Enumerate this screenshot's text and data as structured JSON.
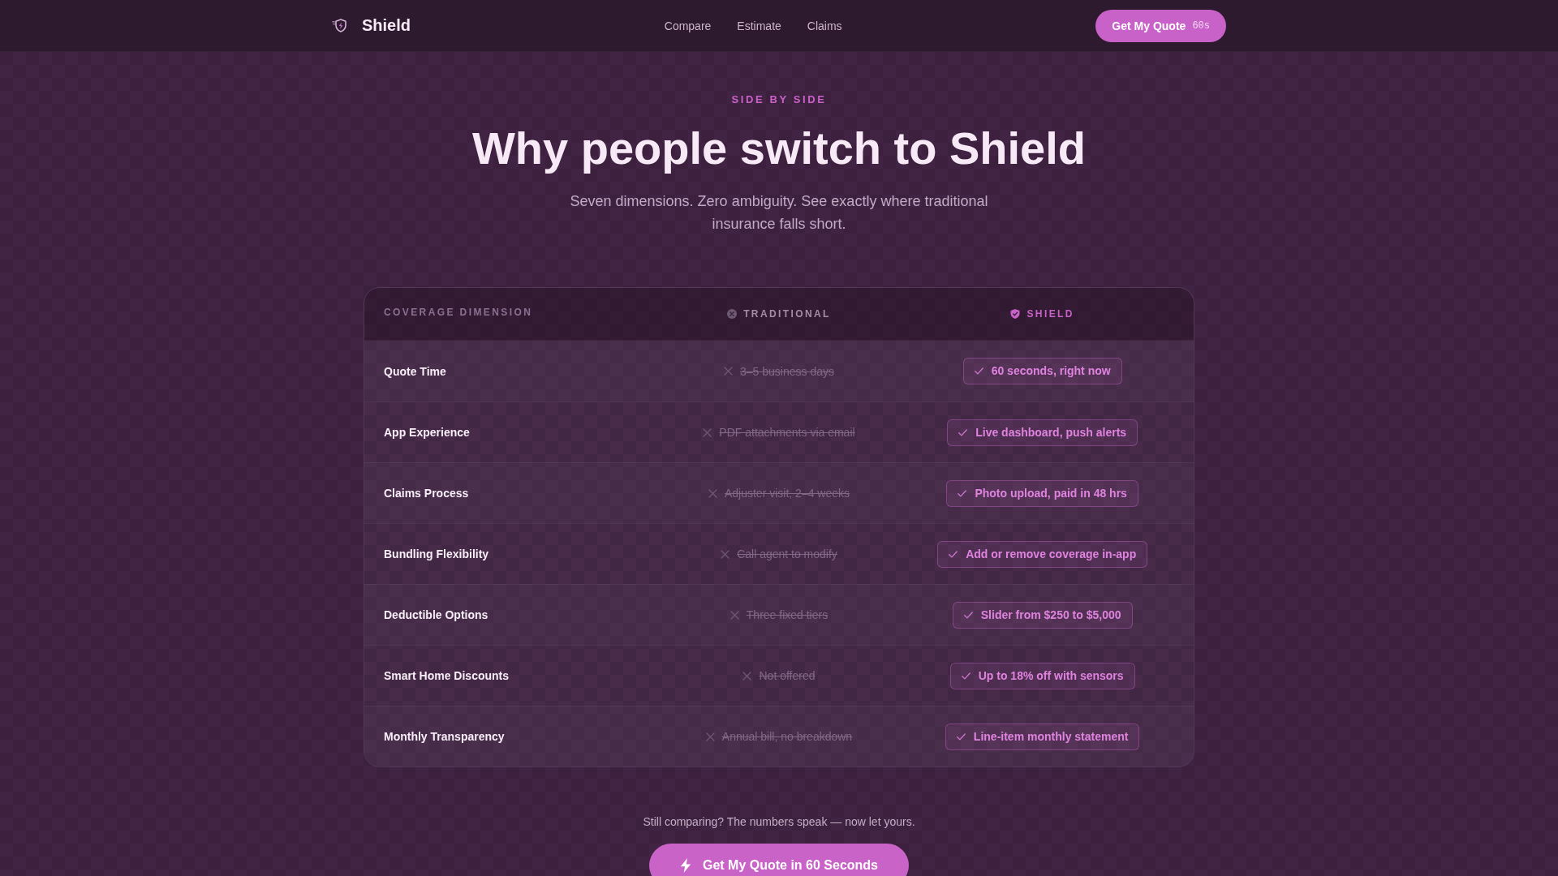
{
  "nav": {
    "brand": "Shield",
    "links": [
      "Compare",
      "Estimate",
      "Claims"
    ],
    "cta": {
      "label": "Get My Quote",
      "timer": "60s"
    }
  },
  "hero": {
    "eyebrow": "SIDE BY SIDE",
    "title": "Why people switch to Shield",
    "subtitle": "Seven dimensions. Zero ambiguity. See exactly where traditional insurance falls short."
  },
  "comparison": {
    "columns": [
      {
        "kind": "dimension",
        "label": "COVERAGE DIMENSION"
      },
      {
        "kind": "traditional",
        "label": "TRADITIONAL"
      },
      {
        "kind": "shield",
        "label": "SHIELD"
      }
    ],
    "rows": [
      {
        "dimension": "Quote Time",
        "traditional": "3–5 business days",
        "shield": "60 seconds, right now"
      },
      {
        "dimension": "App Experience",
        "traditional": "PDF attachments via email",
        "shield": "Live dashboard, push alerts"
      },
      {
        "dimension": "Claims Process",
        "traditional": "Adjuster visit, 2–4 weeks",
        "shield": "Photo upload, paid in 48 hrs"
      },
      {
        "dimension": "Bundling Flexibility",
        "traditional": "Call agent to modify",
        "shield": "Add or remove coverage in-app"
      },
      {
        "dimension": "Deductible Options",
        "traditional": "Three fixed tiers",
        "shield": "Slider from $250 to $5,000"
      },
      {
        "dimension": "Smart Home Discounts",
        "traditional": "Not offered",
        "shield": "Up to 18% off with sensors"
      },
      {
        "dimension": "Monthly Transparency",
        "traditional": "Annual bill, no breakdown",
        "shield": "Line-item monthly statement"
      }
    ]
  },
  "closing": {
    "prompt": "Still comparing? The numbers speak — now let yours.",
    "button": "Get My Quote in 60 Seconds"
  }
}
